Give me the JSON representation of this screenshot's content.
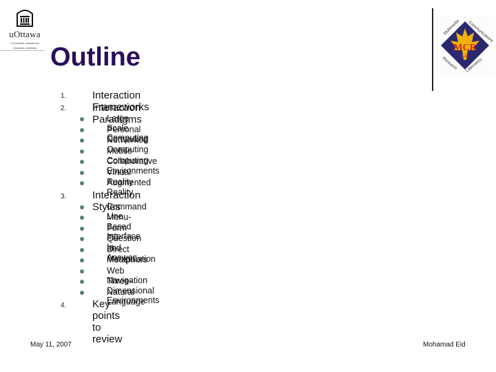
{
  "header": {
    "logo_left": {
      "name": "uOttawa",
      "tagline": [
        "L'Université canadienne",
        "Canada's university"
      ]
    },
    "logo_right": {
      "name": "MCRLab",
      "ring_text": [
        "Multimedia",
        "Communications",
        "Research",
        "Laboratory"
      ]
    },
    "title": "Outline"
  },
  "outline": [
    {
      "number": "1.",
      "label": "Interaction Frameworks",
      "subitems": []
    },
    {
      "number": "2.",
      "label": "Interaction Paradigms",
      "subitems": [
        "Large Scale Computing",
        "Personal Computing",
        "Networked Computing",
        "Mobile Computing",
        "Collaborative Environments",
        "Virtual Reality",
        "Augmented Reality"
      ]
    },
    {
      "number": "3.",
      "label": "Interaction Styles",
      "subitems": [
        "Command Line",
        "Menu-Based Interface",
        "Form Fill-In",
        "Question and Answer",
        "Direct Manipulation",
        "Metaphors",
        "Web Navigation",
        "Three-Dimensional Environments",
        "Natural Language"
      ]
    },
    {
      "number": "4.",
      "label": "Key points to review",
      "subitems": []
    }
  ],
  "footer": {
    "date": "May 11, 2007",
    "author": "Mohamad Eid"
  },
  "colors": {
    "title": "#2a0f5a",
    "bullet": "#5a8080"
  }
}
